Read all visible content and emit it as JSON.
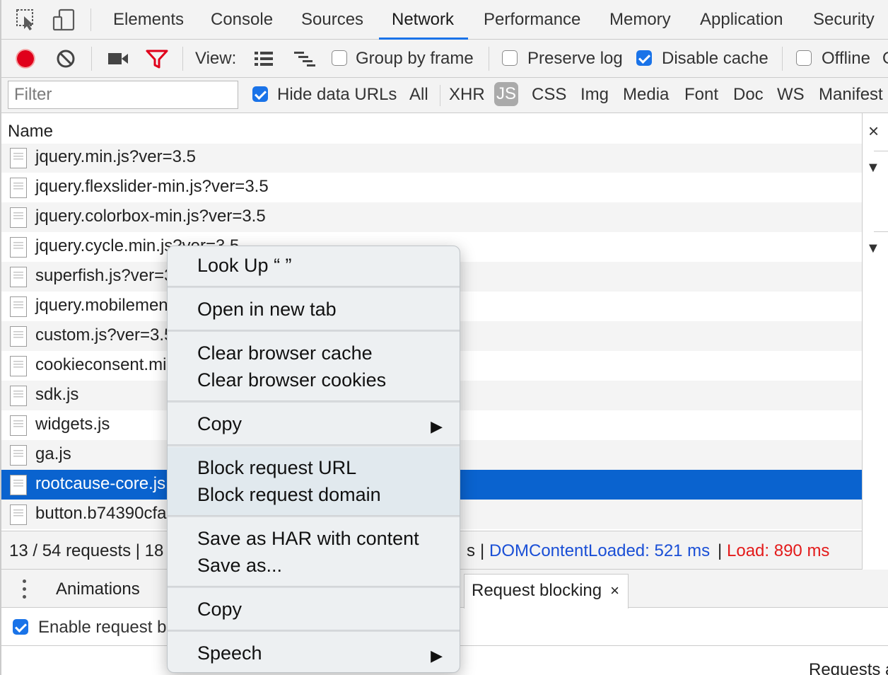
{
  "tabs": [
    "Elements",
    "Console",
    "Sources",
    "Network",
    "Performance",
    "Memory",
    "Application",
    "Security"
  ],
  "active_tab": "Network",
  "toolbar": {
    "view_label": "View:",
    "group_by_frame": "Group by frame",
    "preserve_log": "Preserve log",
    "disable_cache": "Disable cache",
    "offline": "Offline",
    "cut_glyph": "O",
    "record_color": "#e0001b",
    "filter_color": "#e0001b"
  },
  "filterbar": {
    "placeholder": "Filter",
    "hide_data_urls": "Hide data URLs",
    "types": [
      "All",
      "XHR",
      "JS",
      "CSS",
      "Img",
      "Media",
      "Font",
      "Doc",
      "WS",
      "Manifest"
    ],
    "selected_type": "JS"
  },
  "columns": {
    "name": "Name"
  },
  "close_glyph": "×",
  "rows": [
    {
      "name": "jquery.min.js?ver=3.5"
    },
    {
      "name": "jquery.flexslider-min.js?ver=3.5"
    },
    {
      "name": "jquery.colorbox-min.js?ver=3.5"
    },
    {
      "name": "jquery.cycle.min.js?ver=3.5"
    },
    {
      "name": "superfish.js?ver=3"
    },
    {
      "name": "jquery.mobilemen"
    },
    {
      "name": "custom.js?ver=3.5"
    },
    {
      "name": "cookieconsent.mi"
    },
    {
      "name": "sdk.js"
    },
    {
      "name": "widgets.js"
    },
    {
      "name": "ga.js"
    },
    {
      "name": "rootcause-core.js"
    },
    {
      "name": "button.b74390cfa"
    }
  ],
  "selected_row": "rootcause-core.js",
  "status": {
    "requests": "13 / 54 requests | 18",
    "tail": "s",
    "sep": "|",
    "dom_content_loaded": "DOMContentLoaded: 521 ms",
    "load": "Load: 890 ms",
    "dom_color": "#1a4fd6",
    "load_color": "#e31b1b"
  },
  "drawer": {
    "tabs": [
      "Animations",
      "Request blocking"
    ],
    "active_tab": "Request blocking",
    "tab_close": "×",
    "enable_label": "Enable request bl",
    "requests_hint": "Requests a"
  },
  "context_menu": {
    "groups": [
      [
        {
          "label": "Look Up “ ”"
        }
      ],
      [
        {
          "label": "Open in new tab"
        }
      ],
      [
        {
          "label": "Clear browser cache"
        },
        {
          "label": "Clear browser cookies"
        }
      ],
      [
        {
          "label": "Copy",
          "submenu": true
        }
      ],
      [
        {
          "label": "Block request URL"
        },
        {
          "label": "Block request domain"
        }
      ],
      [
        {
          "label": "Save as HAR with content"
        },
        {
          "label": "Save as..."
        }
      ],
      [
        {
          "label": "Copy"
        }
      ],
      [
        {
          "label": "Speech",
          "submenu": true
        }
      ]
    ],
    "submenu_arrow": "▶"
  },
  "accent_color": "#1a73e8",
  "selection_color": "#0a63cf"
}
